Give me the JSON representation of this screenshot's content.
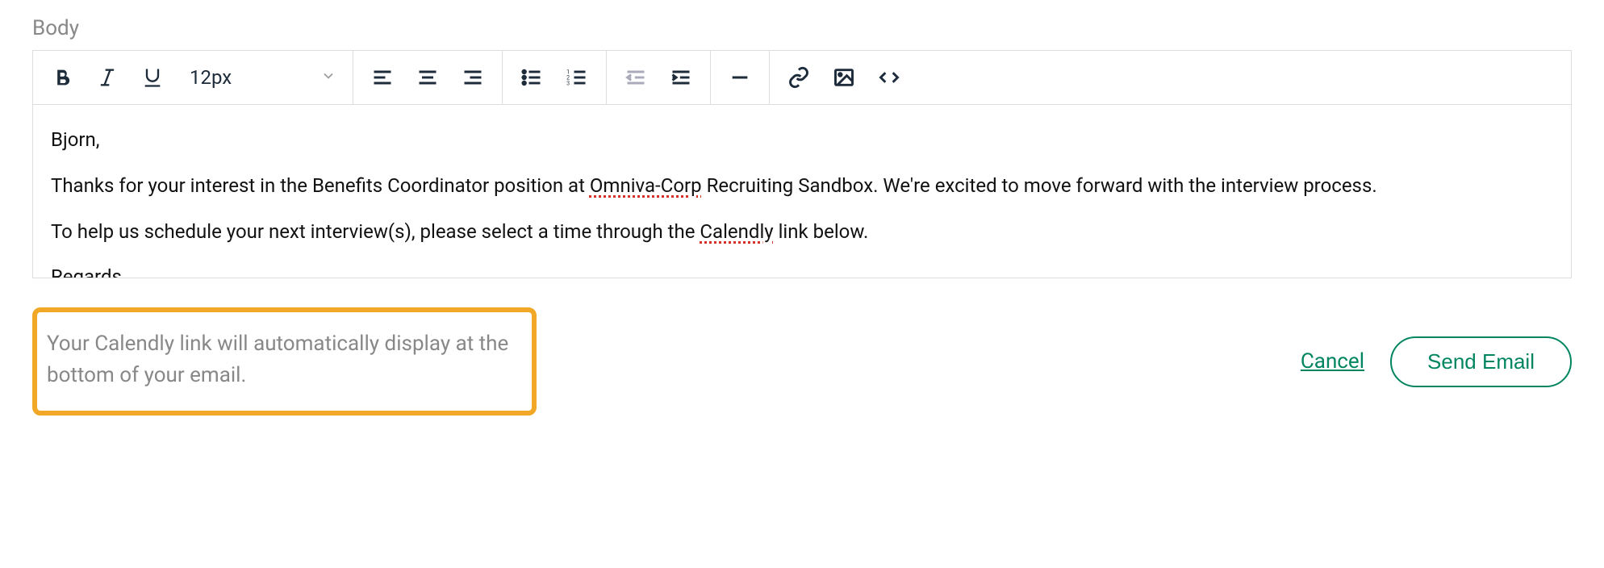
{
  "label": "Body",
  "toolbar": {
    "font_size": "12px"
  },
  "body": {
    "greeting": "Bjorn,",
    "p1_a": "Thanks for your interest in the Benefits Coordinator position at ",
    "p1_spell": "Omniva-Corp",
    "p1_b": " Recruiting Sandbox. We're excited to move forward with the interview process.",
    "p2_a": "To help us schedule your next interview(s), please select a time through the ",
    "p2_spell": "Calendly",
    "p2_b": " link below.",
    "p3": "Regards,"
  },
  "callout": "Your Calendly link will automatically display at the bottom of your email.",
  "actions": {
    "cancel": "Cancel",
    "send": "Send Email"
  }
}
